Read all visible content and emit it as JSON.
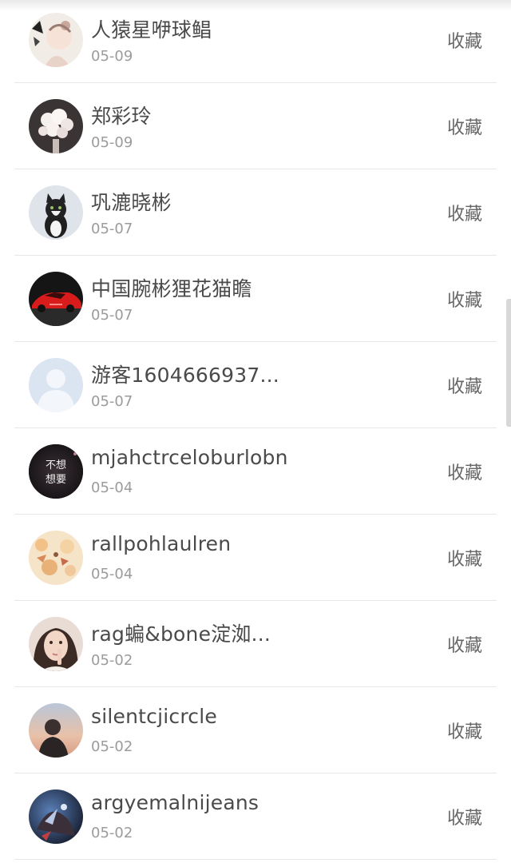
{
  "list": {
    "items": [
      {
        "name": "人猿星咿球鲳",
        "date": "05-09",
        "action": "收藏",
        "avatar": "avatar-girl-illustration"
      },
      {
        "name": "郑彩玲",
        "date": "05-09",
        "action": "收藏",
        "avatar": "avatar-flower-bouquet"
      },
      {
        "name": "巩漉晓彬",
        "date": "05-07",
        "action": "收藏",
        "avatar": "avatar-kitten"
      },
      {
        "name": "中国腕彬狸花猫瞻",
        "date": "05-07",
        "action": "收藏",
        "avatar": "avatar-red-car"
      },
      {
        "name": "游客1604666937...",
        "date": "05-07",
        "action": "收藏",
        "avatar": "avatar-default-user"
      },
      {
        "name": "mjahctrceloburlobn",
        "date": "05-04",
        "action": "收藏",
        "avatar": "avatar-text-image",
        "avatar_text": "不想\n想要"
      },
      {
        "name": "rallpohlaulren",
        "date": "05-04",
        "action": "收藏",
        "avatar": "avatar-cartoon-pattern"
      },
      {
        "name": "rag蝙&bone淀洳...",
        "date": "05-02",
        "action": "收藏",
        "avatar": "avatar-woman-photo"
      },
      {
        "name": "silentcjicrcle",
        "date": "05-02",
        "action": "收藏",
        "avatar": "avatar-man-sunset"
      },
      {
        "name": "argyemalnijeans",
        "date": "05-02",
        "action": "收藏",
        "avatar": "avatar-dark-art"
      }
    ]
  },
  "colors": {
    "name_text": "#4a4a4a",
    "date_text": "#9b9b9b",
    "action_text": "#666666",
    "divider": "#e6e6e6"
  }
}
